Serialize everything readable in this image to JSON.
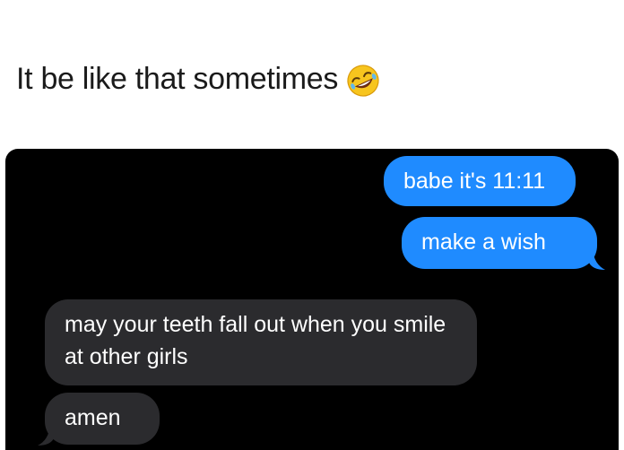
{
  "post": {
    "caption": "It be like that sometimes",
    "caption_emoji": "rolling-on-floor-laughing-emoji"
  },
  "conversation": {
    "messages": [
      {
        "side": "sent",
        "text": "babe it's 11:11"
      },
      {
        "side": "sent",
        "text": "make a wish"
      },
      {
        "side": "received",
        "text": "may your teeth fall out when you smile at other girls"
      },
      {
        "side": "received",
        "text": "amen"
      }
    ]
  },
  "colors": {
    "sent_bubble": "#1f8bff",
    "received_bubble": "#2b2b2e",
    "chat_background": "#000000"
  }
}
